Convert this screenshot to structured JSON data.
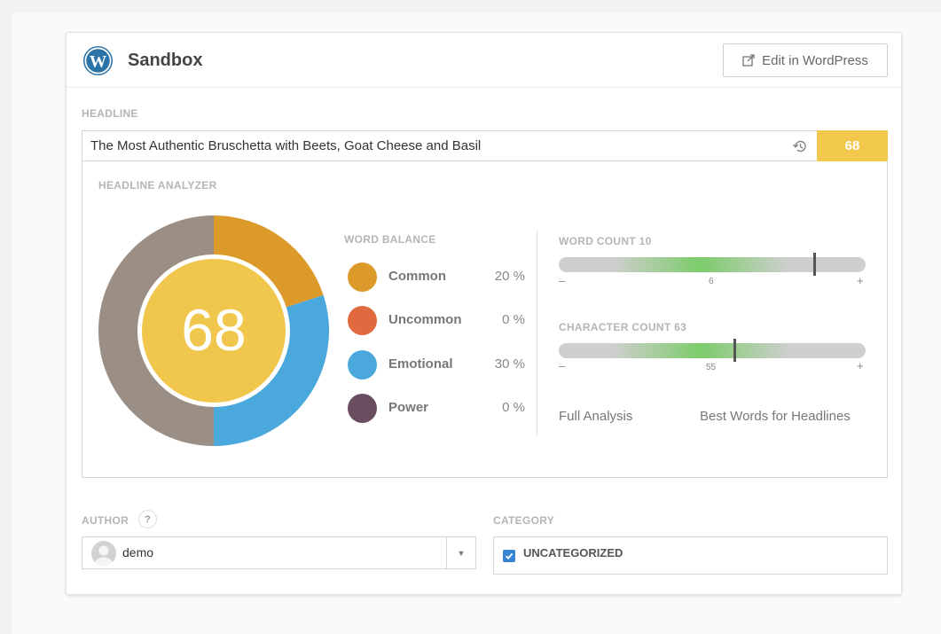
{
  "header": {
    "site_title": "Sandbox",
    "edit_button_label": "Edit in WordPress"
  },
  "headline": {
    "section_label": "HEADLINE",
    "value": "The Most Authentic Bruschetta with Beets, Goat Cheese and Basil",
    "score": "68"
  },
  "analyzer": {
    "section_label": "HEADLINE ANALYZER",
    "donut_score": "68",
    "word_balance": {
      "title": "WORD BALANCE",
      "items": [
        {
          "label": "Common",
          "value": "20 %",
          "color": "#dc9a2b"
        },
        {
          "label": "Uncommon",
          "value": "0 %",
          "color": "#e1693f"
        },
        {
          "label": "Emotional",
          "value": "30 %",
          "color": "#4aa8dc"
        },
        {
          "label": "Power",
          "value": "0 %",
          "color": "#6a4e5f"
        }
      ]
    },
    "word_count": {
      "title": "WORD COUNT 10",
      "minus": "–",
      "plus": "+",
      "ideal": "6",
      "value_fraction": 0.83
    },
    "character_count": {
      "title": "CHARACTER COUNT 63",
      "minus": "–",
      "plus": "+",
      "ideal": "55",
      "value_fraction": 0.57
    },
    "links": {
      "full_analysis": "Full Analysis",
      "best_words": "Best Words for Headlines"
    }
  },
  "author": {
    "section_label": "AUTHOR",
    "help": "?",
    "selected": "demo"
  },
  "category": {
    "section_label": "CATEGORY",
    "items": [
      {
        "label": "UNCATEGORIZED",
        "checked": true
      }
    ]
  },
  "colors": {
    "accent_yellow": "#f1c84b",
    "donut_gray": "#9b8f85",
    "green_zone": "#7ccc6a"
  }
}
